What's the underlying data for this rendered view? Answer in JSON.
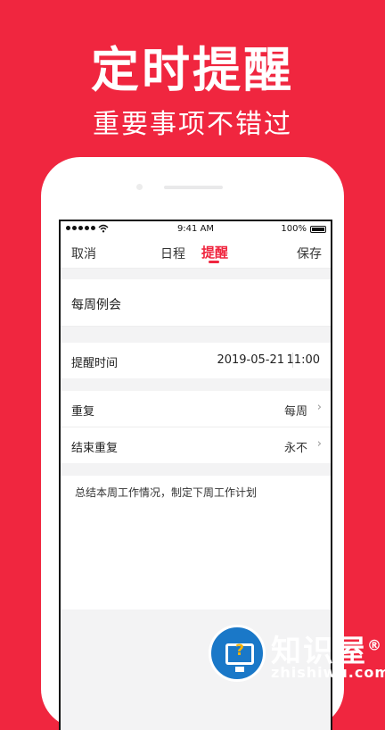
{
  "promo": {
    "headline": "定时提醒",
    "subline": "重要事项不错过"
  },
  "status_bar": {
    "time": "9:41 AM",
    "battery": "100%"
  },
  "nav": {
    "cancel": "取消",
    "tab_schedule": "日程",
    "tab_reminder": "提醒",
    "save": "保存",
    "active_tab": "提醒"
  },
  "event": {
    "title": "每周例会"
  },
  "reminder_time": {
    "label": "提醒时间",
    "date": "2019-05-21",
    "time": "11:00"
  },
  "repeat": {
    "label": "重复",
    "value": "每周"
  },
  "end_repeat": {
    "label": "结束重复",
    "value": "永不"
  },
  "note": {
    "text": "总结本周工作情况，制定下周工作计划"
  },
  "watermark": {
    "name": "知识屋",
    "mark": "®",
    "url": "zhishiwu.com"
  },
  "colors": {
    "accent": "#f0263f",
    "background": "#f3f3f4"
  }
}
